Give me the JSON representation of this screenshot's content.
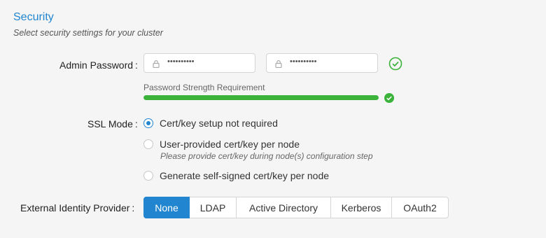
{
  "section": {
    "title": "Security",
    "subtitle": "Select security settings for your cluster"
  },
  "admin_password": {
    "label": "Admin Password",
    "colon": ":",
    "password_value": "••••••••••",
    "confirm_value": "••••••••••",
    "icons": {
      "field": "lock-icon",
      "valid": "check-circle-icon"
    },
    "strength_label": "Password Strength Requirement",
    "strength_fraction": 1.0,
    "strength_color": "#3bb33b"
  },
  "ssl_mode": {
    "label": "SSL Mode",
    "colon": ":",
    "options": [
      {
        "label": "Cert/key setup not required",
        "selected": true
      },
      {
        "label": "User-provided cert/key per node",
        "selected": false,
        "hint": "Please provide cert/key during node(s) configuration step"
      },
      {
        "label": "Generate self-signed cert/key per node",
        "selected": false
      }
    ]
  },
  "identity_provider": {
    "label": "External Identity Provider",
    "colon": ":",
    "options": [
      "None",
      "LDAP",
      "Active Directory",
      "Kerberos",
      "OAuth2"
    ],
    "selected": "None"
  },
  "colors": {
    "accent": "#2185d0",
    "success": "#3bb33b"
  }
}
